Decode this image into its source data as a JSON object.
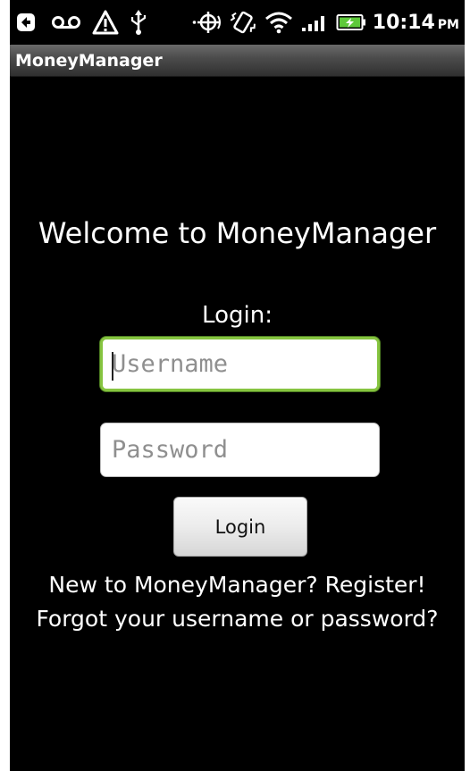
{
  "status_bar": {
    "icons": [
      "back-notification-icon",
      "voicemail-icon",
      "warning-icon",
      "usb-icon",
      "gps-icon",
      "vibrate-icon",
      "wifi-icon",
      "signal-icon",
      "battery-charging-icon"
    ],
    "time": "10:14",
    "ampm": "PM"
  },
  "app": {
    "title": "MoneyManager"
  },
  "main": {
    "welcome": "Welcome to MoneyManager",
    "login_label": "Login:",
    "username_placeholder": "Username",
    "password_placeholder": "Password",
    "login_button": "Login",
    "register_link": "New to MoneyManager? Register!",
    "forgot_link": "Forgot your username or password?"
  },
  "colors": {
    "background": "#000000",
    "focus_border": "#86c440",
    "title_bar": "#4a4a4a",
    "battery_charge": "#5ec93a"
  }
}
